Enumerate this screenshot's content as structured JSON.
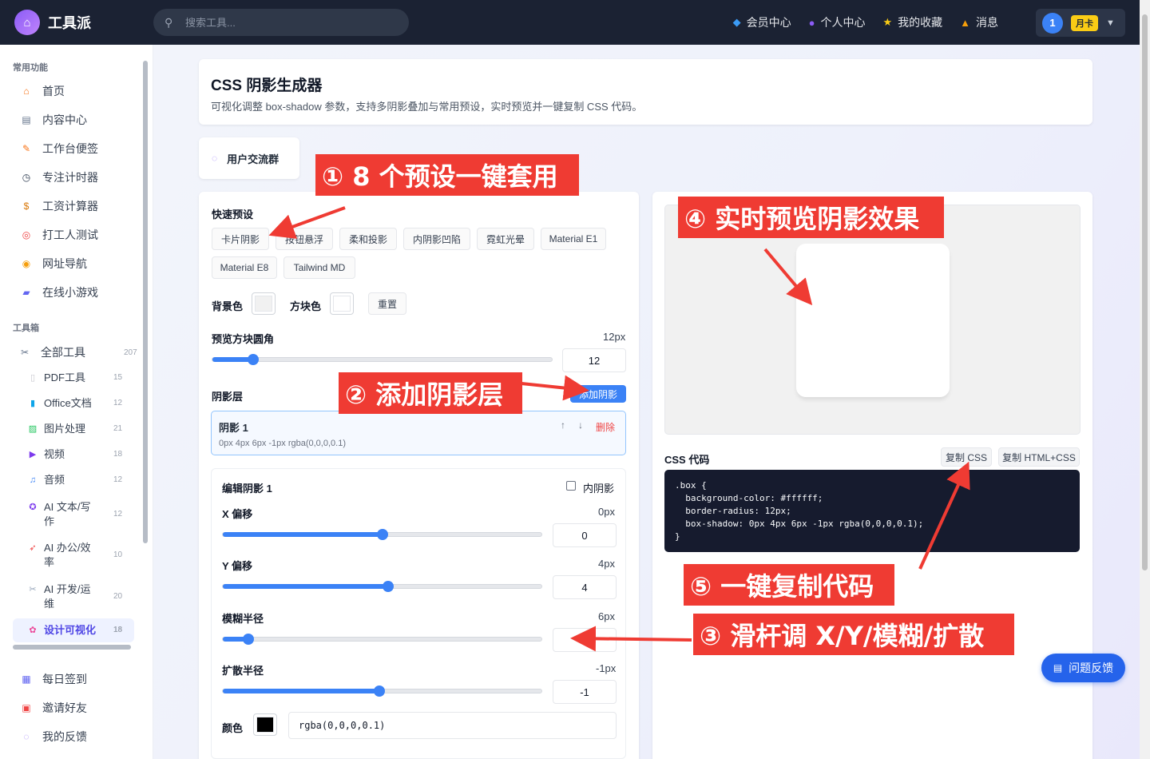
{
  "app": {
    "name": "工具派"
  },
  "search": {
    "placeholder": "搜索工具..."
  },
  "topnav": [
    {
      "icon": "gem-icon",
      "label": "会员中心"
    },
    {
      "icon": "person-icon",
      "label": "个人中心"
    },
    {
      "icon": "star-icon",
      "label": "我的收藏"
    },
    {
      "icon": "bell-icon",
      "label": "消息"
    }
  ],
  "user": {
    "avatar": "1",
    "badge": "月卡"
  },
  "sidebar": {
    "common_title": "常用功能",
    "common": [
      {
        "icon": "home-icon",
        "glyph": "🏠",
        "label": "首页"
      },
      {
        "icon": "news-icon",
        "glyph": "▤",
        "label": "内容中心"
      },
      {
        "icon": "memo-icon",
        "glyph": "✎",
        "label": "工作台便签"
      },
      {
        "icon": "timer-icon",
        "glyph": "◷",
        "label": "专注计时器"
      },
      {
        "icon": "money-bag-icon",
        "glyph": "$",
        "label": "工资计算器"
      },
      {
        "icon": "target-icon",
        "glyph": "◎",
        "label": "打工人测试"
      },
      {
        "icon": "compass-icon",
        "glyph": "◉",
        "label": "网址导航"
      },
      {
        "icon": "gamepad-icon",
        "glyph": "▰",
        "label": "在线小游戏"
      }
    ],
    "tools_title": "工具箱",
    "all_tools": {
      "icon": "tools-icon",
      "label": "全部工具",
      "count": "207"
    },
    "categories": [
      {
        "icon": "pdf-icon",
        "glyph": "▯",
        "label": "PDF工具",
        "count": "15"
      },
      {
        "icon": "office-icon",
        "glyph": "▮",
        "label": "Office文档",
        "count": "12"
      },
      {
        "icon": "image-icon",
        "glyph": "▨",
        "label": "图片处理",
        "count": "21"
      },
      {
        "icon": "video-icon",
        "glyph": "▶",
        "label": "视频",
        "count": "18"
      },
      {
        "icon": "music-icon",
        "glyph": "♫",
        "label": "音频",
        "count": "12"
      },
      {
        "icon": "ai-writing-icon",
        "glyph": "✪",
        "label": "AI 文本/写作",
        "count": "12"
      },
      {
        "icon": "rocket-icon",
        "glyph": "➶",
        "label": "AI 办公/效率",
        "count": "10"
      },
      {
        "icon": "wrench-icon",
        "glyph": "✂",
        "label": "AI 开发/运维",
        "count": "20"
      },
      {
        "icon": "palette-icon",
        "glyph": "✿",
        "label": "设计可视化",
        "count": "18"
      }
    ],
    "bottom": [
      {
        "icon": "calendar-icon",
        "glyph": "▦",
        "label": "每日签到"
      },
      {
        "icon": "gift-icon",
        "glyph": "▣",
        "label": "邀请好友"
      },
      {
        "icon": "feedback-icon",
        "glyph": "◌",
        "label": "我的反馈"
      }
    ]
  },
  "page": {
    "title": "CSS 阴影生成器",
    "desc": "可视化调整 box-shadow 参数，支持多阴影叠加与常用预设，实时预览并一键复制 CSS 代码。"
  },
  "community": {
    "label": "用户交流群"
  },
  "presets": {
    "title": "快速预设",
    "items": [
      "卡片阴影",
      "按钮悬浮",
      "柔和投影",
      "内阴影凹陷",
      "霓虹光晕",
      "Material E1",
      "Material E8",
      "Tailwind MD"
    ]
  },
  "colors": {
    "bg_label": "背景色",
    "box_label": "方块色",
    "reset": "重置",
    "bg_value": "#f1f1f1",
    "box_value": "#ffffff",
    "accent": "#3b82f6",
    "annotation": "#ef3b33"
  },
  "radius": {
    "label": "预览方块圆角",
    "display": "12px",
    "value": "12",
    "fraction": 0.12
  },
  "layers": {
    "title": "阴影层",
    "add": "添加阴影",
    "items": [
      {
        "name": "阴影 1",
        "summary": "0px 4px 6px -1px rgba(0,0,0,0.1)",
        "up": "↑",
        "down": "↓",
        "delete": "删除"
      }
    ]
  },
  "edit": {
    "title": "编辑阴影 1",
    "inset_label": "内阴影",
    "sliders": [
      {
        "label": "X 偏移",
        "display": "0px",
        "value": "0",
        "fraction": 0.5
      },
      {
        "label": "Y 偏移",
        "display": "4px",
        "value": "4",
        "fraction": 0.52
      },
      {
        "label": "模糊半径",
        "display": "6px",
        "value": "6",
        "fraction": 0.08
      },
      {
        "label": "扩散半径",
        "display": "-1px",
        "value": "-1",
        "fraction": 0.49
      }
    ],
    "color_label": "颜色",
    "color_value": "rgba(0,0,0,0.1)"
  },
  "code": {
    "title": "CSS 代码",
    "copy_css": "复制 CSS",
    "copy_html": "复制 HTML+CSS",
    "text": ".box {\n  background-color: #ffffff;\n  border-radius: 12px;\n  box-shadow: 0px 4px 6px -1px rgba(0,0,0,0.1);\n}"
  },
  "annotations": {
    "a1": "① 8 个预设一键套用",
    "a2": "② 添加阴影层",
    "a3": "③ 滑杆调 X/Y/模糊/扩散",
    "a4": "④ 实时预览阴影效果",
    "a5": "⑤ 一键复制代码"
  },
  "feedback_button": "问题反馈"
}
